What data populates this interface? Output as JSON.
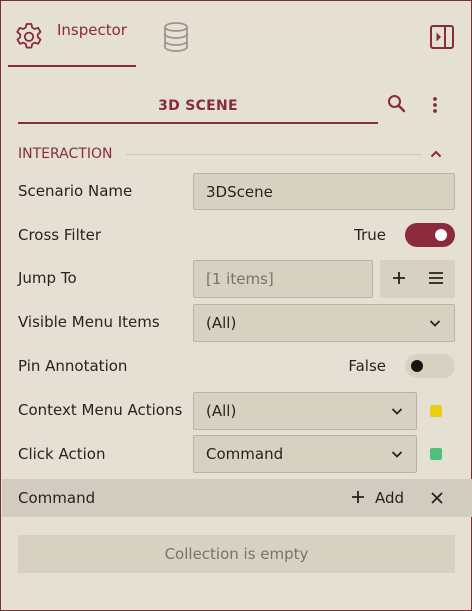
{
  "tabs": {
    "inspector_label": "Inspector",
    "inspector_icon": "gear-icon",
    "data_icon": "database-icon",
    "panel_icon": "panel-toggle-icon"
  },
  "title": {
    "text": "3D SCENE",
    "search_icon": "search-icon",
    "more_icon": "more-vertical-icon"
  },
  "section": {
    "title": "INTERACTION",
    "collapse_icon": "chevron-up-icon"
  },
  "rows": {
    "scenario_name": {
      "label": "Scenario Name",
      "value": "3DScene"
    },
    "cross_filter": {
      "label": "Cross Filter",
      "state_text": "True",
      "on": true
    },
    "jump_to": {
      "label": "Jump To",
      "value": "[1 items]"
    },
    "visible_menu_items": {
      "label": "Visible Menu Items",
      "value": "(All)"
    },
    "pin_annotation": {
      "label": "Pin Annotation",
      "state_text": "False",
      "on": false
    },
    "context_menu_actions": {
      "label": "Context Menu Actions",
      "value": "(All)",
      "swatch": "#e8cf16"
    },
    "click_action": {
      "label": "Click Action",
      "value": "Command",
      "swatch": "#4fc07a"
    }
  },
  "command": {
    "label": "Command",
    "add_label": "Add",
    "empty_text": "Collection is empty"
  },
  "colors": {
    "accent": "#8a2a3a",
    "background": "#e4e0d3",
    "field": "#d6d1c1"
  }
}
